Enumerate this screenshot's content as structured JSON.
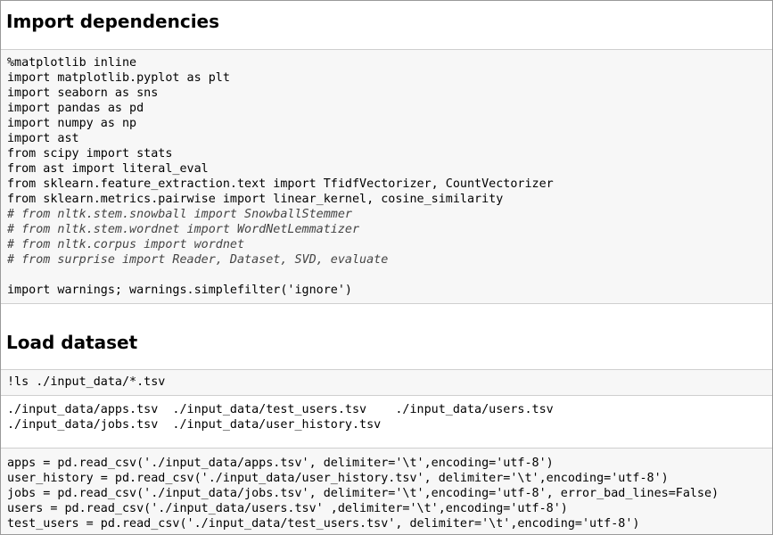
{
  "sections": [
    {
      "heading": "Import dependencies"
    },
    {
      "heading": "Load dataset"
    }
  ],
  "cell1": {
    "lines": [
      "%matplotlib inline",
      "import matplotlib.pyplot as plt",
      "import seaborn as sns",
      "import pandas as pd",
      "import numpy as np",
      "import ast",
      "from scipy import stats",
      "from ast import literal_eval",
      "from sklearn.feature_extraction.text import TfidfVectorizer, CountVectorizer",
      "from sklearn.metrics.pairwise import linear_kernel, cosine_similarity",
      "# from nltk.stem.snowball import SnowballStemmer",
      "# from nltk.stem.wordnet import WordNetLemmatizer",
      "# from nltk.corpus import wordnet",
      "# from surprise import Reader, Dataset, SVD, evaluate",
      "",
      "import warnings; warnings.simplefilter('ignore')"
    ]
  },
  "cell2": {
    "code": "!ls ./input_data/*.tsv",
    "output": [
      "./input_data/apps.tsv  ./input_data/test_users.tsv    ./input_data/users.tsv",
      "./input_data/jobs.tsv  ./input_data/user_history.tsv"
    ]
  },
  "cell3": {
    "lines": [
      "apps = pd.read_csv('./input_data/apps.tsv', delimiter='\\t',encoding='utf-8')",
      "user_history = pd.read_csv('./input_data/user_history.tsv', delimiter='\\t',encoding='utf-8')",
      "jobs = pd.read_csv('./input_data/jobs.tsv', delimiter='\\t',encoding='utf-8', error_bad_lines=False)",
      "users = pd.read_csv('./input_data/users.tsv' ,delimiter='\\t',encoding='utf-8')",
      "test_users = pd.read_csv('./input_data/test_users.tsv', delimiter='\\t',encoding='utf-8')"
    ]
  }
}
